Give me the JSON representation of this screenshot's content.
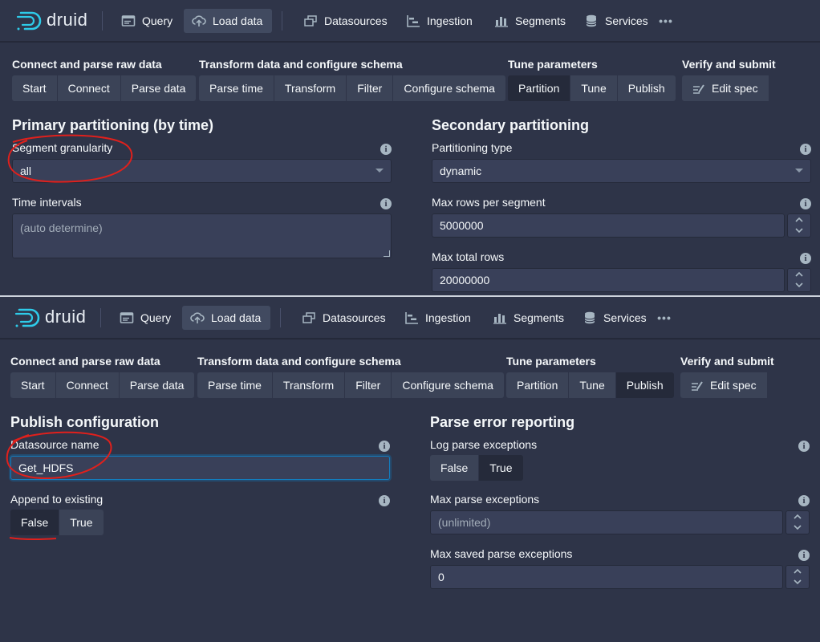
{
  "brand": {
    "logo_text": "druid"
  },
  "navbar": {
    "items": [
      {
        "label": "Query",
        "icon": "application-icon"
      },
      {
        "label": "Load data",
        "icon": "cloud-upload-icon"
      },
      {
        "label": "Datasources",
        "icon": "multi-select-icon"
      },
      {
        "label": "Ingestion",
        "icon": "gantt-chart-icon"
      },
      {
        "label": "Segments",
        "icon": "stacked-chart-icon"
      },
      {
        "label": "Services",
        "icon": "database-icon"
      }
    ],
    "more_label": "•••"
  },
  "steps": {
    "groups": [
      {
        "label": "Connect and parse raw data",
        "buttons": [
          "Start",
          "Connect",
          "Parse data"
        ]
      },
      {
        "label": "Transform data and configure schema",
        "buttons": [
          "Parse time",
          "Transform",
          "Filter",
          "Configure schema"
        ]
      },
      {
        "label": "Tune parameters",
        "buttons": [
          "Partition",
          "Tune",
          "Publish"
        ]
      },
      {
        "label": "Verify and submit",
        "buttons": [
          "Edit spec"
        ]
      }
    ]
  },
  "partition_view": {
    "primary_title": "Primary partitioning (by time)",
    "segment_granularity_label": "Segment granularity",
    "segment_granularity_value": "all",
    "time_intervals_label": "Time intervals",
    "time_intervals_placeholder": "(auto determine)",
    "secondary_title": "Secondary partitioning",
    "partitioning_type_label": "Partitioning type",
    "partitioning_type_value": "dynamic",
    "max_rows_per_segment_label": "Max rows per segment",
    "max_rows_per_segment_value": "5000000",
    "max_total_rows_label": "Max total rows",
    "max_total_rows_value": "20000000"
  },
  "publish_view": {
    "publish_title": "Publish configuration",
    "datasource_name_label": "Datasource name",
    "datasource_name_value": "Get_HDFS",
    "append_label": "Append to existing",
    "append_options": [
      "False",
      "True"
    ],
    "parse_error_title": "Parse error reporting",
    "log_parse_label": "Log parse exceptions",
    "log_parse_options": [
      "False",
      "True"
    ],
    "max_parse_label": "Max parse exceptions",
    "max_parse_placeholder": "(unlimited)",
    "max_saved_label": "Max saved parse exceptions",
    "max_saved_value": "0"
  },
  "colors": {
    "background": "#2e3448",
    "button": "#3b4357",
    "button_active": "#252a3a",
    "input": "#394059",
    "annotation": "#e0201c",
    "focus": "#137cbd"
  }
}
